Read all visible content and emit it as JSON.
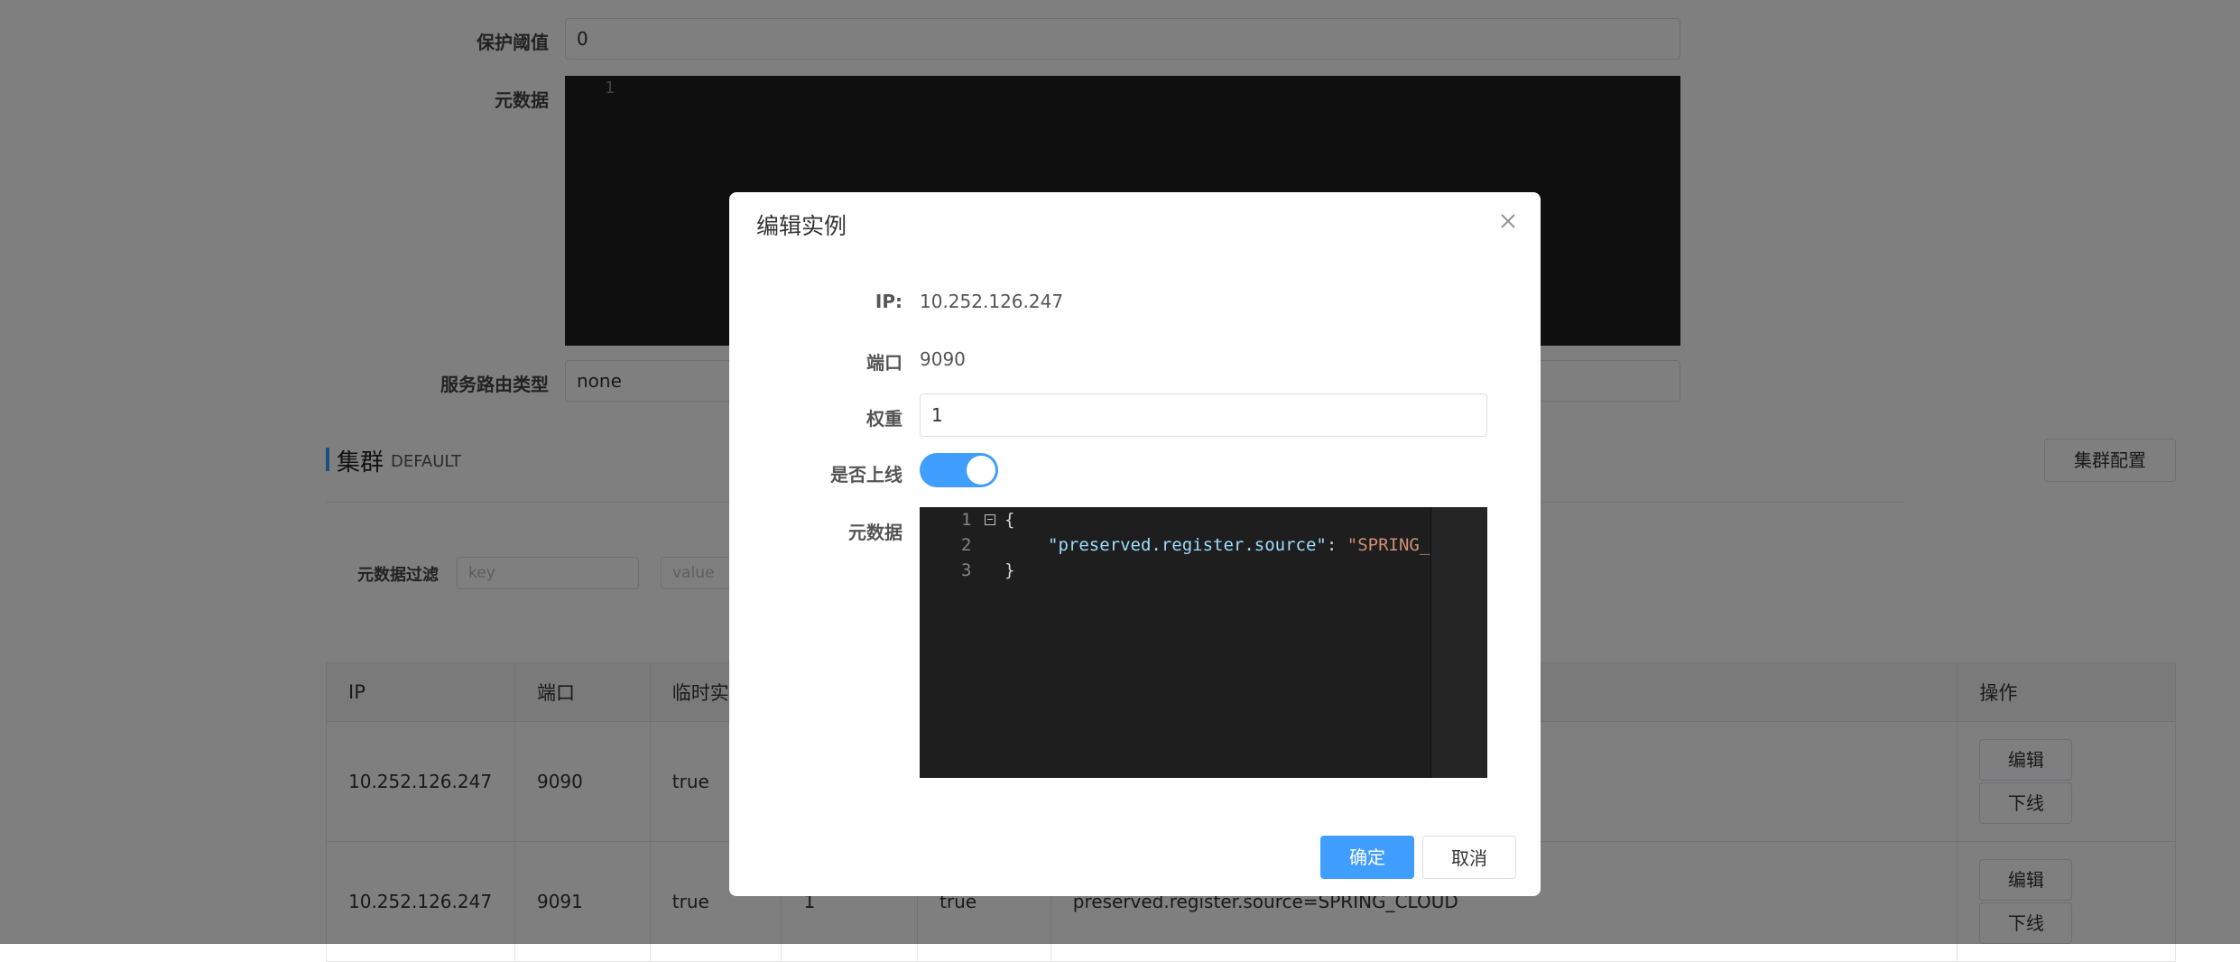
{
  "background": {
    "form": {
      "protect_threshold_label": "保护阈值",
      "protect_threshold_value": "0",
      "metadata_label": "元数据",
      "metadata_editor_line": "1",
      "route_type_label": "服务路由类型",
      "route_type_value": "none"
    },
    "cluster": {
      "title": "集群",
      "name": "DEFAULT",
      "config_button": "集群配置",
      "filter_label": "元数据过滤",
      "filter_key_placeholder": "key",
      "filter_value_placeholder": "value"
    },
    "table": {
      "headers": [
        "IP",
        "端口",
        "临时实",
        "",
        "",
        "",
        "操作"
      ],
      "rows": [
        {
          "ip": "10.252.126.247",
          "port": "9090",
          "ephemeral": "true",
          "weight": "",
          "healthy": "",
          "metadata": ""
        },
        {
          "ip": "10.252.126.247",
          "port": "9091",
          "ephemeral": "true",
          "weight": "1",
          "healthy": "true",
          "metadata": "preserved.register.source=SPRING_CLOUD"
        }
      ],
      "edit_label": "编辑",
      "offline_label": "下线"
    }
  },
  "dialog": {
    "title": "编辑实例",
    "ip_label": "IP:",
    "ip_value": "10.252.126.247",
    "port_label": "端口",
    "port_value": "9090",
    "weight_label": "权重",
    "weight_value": "1",
    "online_label": "是否上线",
    "online": true,
    "metadata_label": "元数据",
    "editor_lines": [
      {
        "num": "1",
        "text": "{"
      },
      {
        "num": "2",
        "key": "\"preserved.register.source\"",
        "sep": ": ",
        "value": "\"SPRING_"
      },
      {
        "num": "3",
        "text": "}"
      }
    ],
    "confirm_label": "确定",
    "cancel_label": "取消"
  },
  "colors": {
    "primary": "#409eff",
    "editor_bg": "#1e1e1e",
    "json_key": "#9cdcfe",
    "json_string": "#ce9178"
  }
}
